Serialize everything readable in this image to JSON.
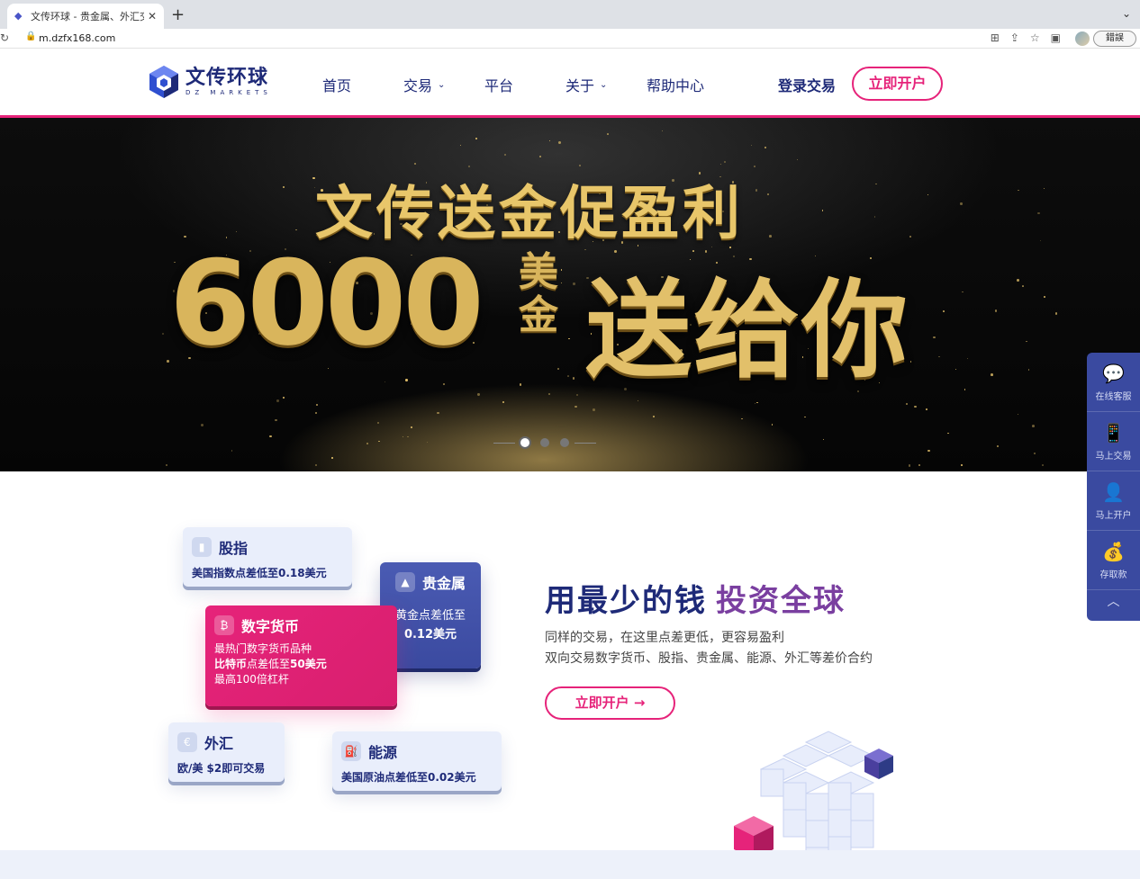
{
  "browser": {
    "tab_title": "文传环球 - 贵金属、外汇交易、指",
    "url": "m.dzfx168.com",
    "error_button": "錯誤"
  },
  "header": {
    "logo_cn": "文传环球",
    "logo_en": "DZ MARKETS",
    "nav": [
      "首页",
      "交易",
      "平台",
      "关于",
      "帮助中心"
    ],
    "login": "登录交易",
    "open_account": "立即开户"
  },
  "hero": {
    "line1": "文传送金促盈利",
    "amount": "6000",
    "unit": "美金",
    "line2": "送给你",
    "active_slide": 1,
    "slide_count": 3
  },
  "side_panel": [
    "在线客服",
    "马上交易",
    "马上开户",
    "存取款"
  ],
  "cards": {
    "index": {
      "name": "股指",
      "desc": "美国指数点差低至0.18美元"
    },
    "metals": {
      "name": "贵金属",
      "desc": "黄金点差低至",
      "desc2": "0.12美元"
    },
    "crypto": {
      "name": "数字货币",
      "l1": "最热门数字货币品种",
      "l2a": "比特币",
      "l2b": "点差低至",
      "l2c": "50美元",
      "l3": "最高100倍杠杆"
    },
    "forex": {
      "name": "外汇",
      "desc": "欧/美 $2即可交易"
    },
    "energy": {
      "name": "能源",
      "desc": "美国原油点差低至0.02美元"
    }
  },
  "promo": {
    "headline": "用最少的钱",
    "headline_accent": "投资全球",
    "line1": "同样的交易，在这里点差更低，更容易盈利",
    "line2": "双向交易数字货币、股指、贵金属、能源、外汇等差价合约",
    "cta": "立即开户 →"
  },
  "colors": {
    "brand_navy": "#1e2a78",
    "brand_pink": "#e6237a",
    "gold": "#d9b55c"
  }
}
